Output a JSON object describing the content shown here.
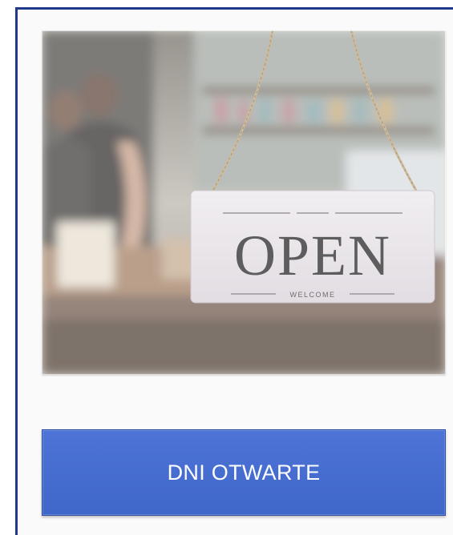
{
  "photo": {
    "sign_text": "OPEN",
    "sign_subtext": "WELCOME"
  },
  "banner": {
    "label": "DNI OTWARTE"
  },
  "colors": {
    "frame_border": "#1f3a8a",
    "banner_fill": "#4a70d2",
    "banner_text": "#ffffff"
  }
}
